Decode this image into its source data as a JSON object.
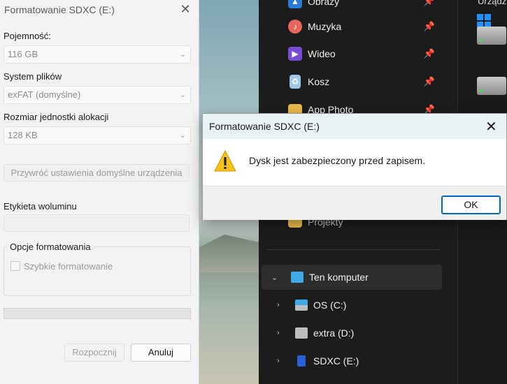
{
  "format_dialog": {
    "title": "Formatowanie SDXC (E:)",
    "capacity_label": "Pojemność:",
    "capacity_value": "116 GB",
    "filesystem_label": "System plików",
    "filesystem_value": "exFAT (domyślne)",
    "alloc_label": "Rozmiar jednostki alokacji",
    "alloc_value": "128 KB",
    "restore_button": "Przywróć ustawienia domyślne urządzenia",
    "volume_label": "Etykieta woluminu",
    "volume_value": "",
    "options_title": "Opcje formatowania",
    "quick_format_label": "Szybkie formatowanie",
    "quick_format_checked": false,
    "progress": 0,
    "start_button": "Rozpocznij",
    "cancel_button": "Anuluj"
  },
  "message_box": {
    "title": "Formatowanie SDXC (E:)",
    "message": "Dysk jest zabezpieczony przed zapisem.",
    "ok_button": "OK",
    "icon": "warning-icon"
  },
  "explorer": {
    "quick_access": [
      {
        "label": "Obrazy",
        "icon": "pictures-icon",
        "color": "#2a7bd6",
        "pinned": true
      },
      {
        "label": "Muzyka",
        "icon": "music-icon",
        "color": "#e8665a",
        "pinned": true
      },
      {
        "label": "Wideo",
        "icon": "video-icon",
        "color": "#7a4cd6",
        "pinned": true
      },
      {
        "label": "Kosz",
        "icon": "recycle-bin-icon",
        "color": "#9fc8e8",
        "pinned": true
      },
      {
        "label": "App Photo",
        "icon": "folder-icon",
        "color": "#e9b94a",
        "pinned": true
      },
      {
        "label": "Projekty",
        "icon": "folder-icon",
        "color": "#e9b94a",
        "pinned": false
      }
    ],
    "this_pc": {
      "label": "Ten komputer",
      "expanded": true
    },
    "drives": [
      {
        "label": "OS (C:)",
        "icon": "os-drive-icon"
      },
      {
        "label": "extra (D:)",
        "icon": "drive-icon"
      },
      {
        "label": "SDXC (E:)",
        "icon": "sd-card-icon"
      }
    ],
    "right_header": "Urządz"
  },
  "colors": {
    "accent": "#0067c0",
    "warning": "#f7c31a",
    "explorer_bg": "#1c1c1c"
  }
}
